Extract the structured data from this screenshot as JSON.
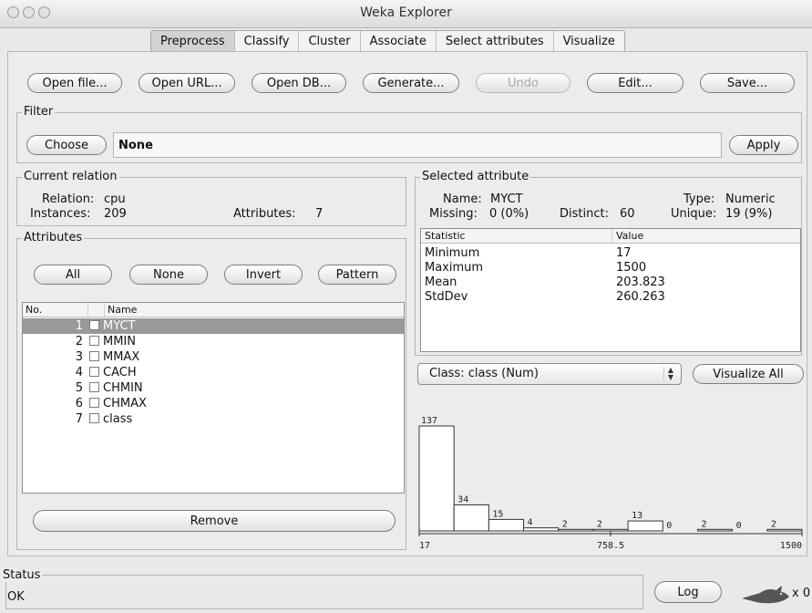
{
  "window": {
    "title": "Weka Explorer"
  },
  "tabs": [
    {
      "label": "Preprocess",
      "active": true
    },
    {
      "label": "Classify",
      "active": false
    },
    {
      "label": "Cluster",
      "active": false
    },
    {
      "label": "Associate",
      "active": false
    },
    {
      "label": "Select attributes",
      "active": false
    },
    {
      "label": "Visualize",
      "active": false
    }
  ],
  "toolbar": {
    "open_file": "Open file...",
    "open_url": "Open URL...",
    "open_db": "Open DB...",
    "generate": "Generate...",
    "undo": "Undo",
    "edit": "Edit...",
    "save": "Save..."
  },
  "filter": {
    "title": "Filter",
    "choose": "Choose",
    "value": "None",
    "apply": "Apply"
  },
  "current_relation": {
    "title": "Current relation",
    "relation_label": "Relation:",
    "relation": "cpu",
    "instances_label": "Instances:",
    "instances": "209",
    "attributes_label": "Attributes:",
    "attributes": "7"
  },
  "attributes": {
    "title": "Attributes",
    "buttons": {
      "all": "All",
      "none": "None",
      "invert": "Invert",
      "pattern": "Pattern"
    },
    "col_no": "No.",
    "col_name": "Name",
    "rows": [
      {
        "no": "1",
        "name": "MYCT"
      },
      {
        "no": "2",
        "name": "MMIN"
      },
      {
        "no": "3",
        "name": "MMAX"
      },
      {
        "no": "4",
        "name": "CACH"
      },
      {
        "no": "5",
        "name": "CHMIN"
      },
      {
        "no": "6",
        "name": "CHMAX"
      },
      {
        "no": "7",
        "name": "class"
      }
    ],
    "selected_index": 0,
    "remove": "Remove"
  },
  "selected_attribute": {
    "title": "Selected attribute",
    "name_label": "Name:",
    "name": "MYCT",
    "type_label": "Type:",
    "type": "Numeric",
    "missing_label": "Missing:",
    "missing": "0 (0%)",
    "distinct_label": "Distinct:",
    "distinct": "60",
    "unique_label": "Unique:",
    "unique": "19 (9%)",
    "col_statistic": "Statistic",
    "col_value": "Value",
    "stats": [
      {
        "statistic": "Minimum",
        "value": "17"
      },
      {
        "statistic": "Maximum",
        "value": "1500"
      },
      {
        "statistic": "Mean",
        "value": "203.823"
      },
      {
        "statistic": "StdDev",
        "value": "260.263"
      }
    ]
  },
  "class_select": {
    "value": "Class: class (Num)"
  },
  "visualize_all": "Visualize All",
  "histogram": {
    "bins": [
      137,
      34,
      15,
      4,
      2,
      2,
      13,
      0,
      2,
      0,
      2
    ],
    "labels": [
      "137",
      "34",
      "15",
      "4",
      "2",
      "2",
      "13",
      "0",
      "2",
      "0",
      "2"
    ],
    "axis_labels": [
      "17",
      "758.5",
      "1500"
    ]
  },
  "status": {
    "title": "Status",
    "text": "OK",
    "log": "Log",
    "count": "x 0",
    "icon": "weka-bird-icon"
  }
}
